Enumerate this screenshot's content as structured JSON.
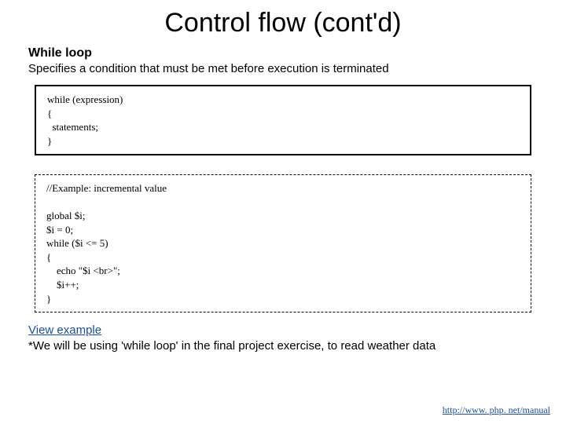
{
  "title": "Control flow (cont'd)",
  "section": {
    "heading": "While loop",
    "description": "Specifies a condition that must be met before execution is terminated"
  },
  "syntax_box": "while (expression)\n{\n  statements;\n}",
  "example_box": "//Example: incremental value\n\nglobal $i;\n$i = 0;\nwhile ($i <= 5)\n{\n    echo \"$i <br>\";\n    $i++;\n}",
  "link_text": "View example",
  "note_text": "*We will be using 'while loop' in the final project exercise, to read weather data",
  "footer_url": "http://www. php. net/manual"
}
